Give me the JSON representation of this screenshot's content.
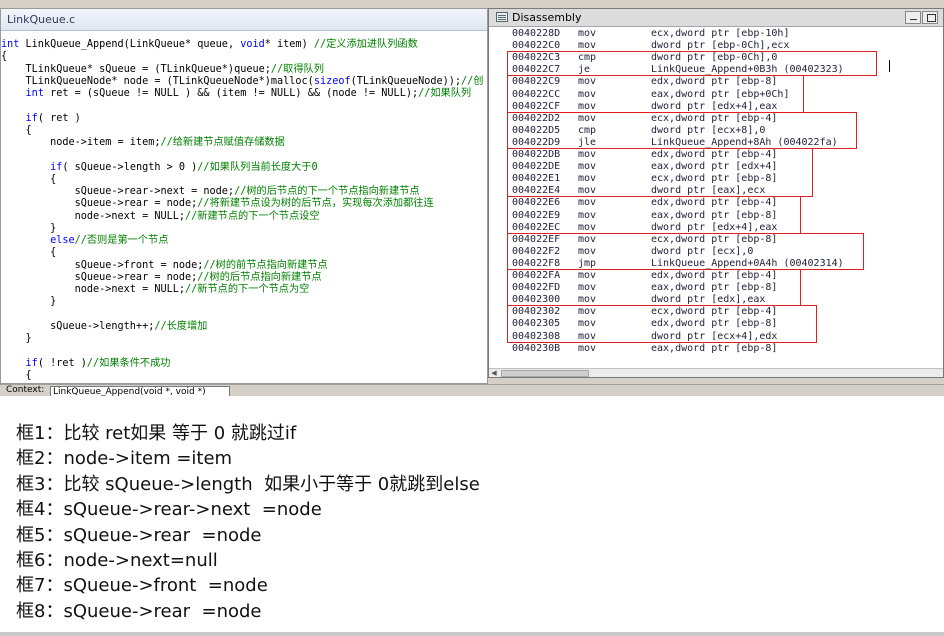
{
  "source_window": {
    "tab_title": "LinkQueue.c",
    "code_lines": [
      [
        {
          "t": "int",
          "c": "kw"
        },
        {
          "t": " LinkQueue_Append(LinkQueue* queue, "
        },
        {
          "t": "void",
          "c": "kw"
        },
        {
          "t": "* item) "
        },
        {
          "t": "//定义添加进队列函数",
          "c": "cm"
        }
      ],
      [
        {
          "t": "{"
        }
      ],
      [
        {
          "t": "    TLinkQueue* sQueue = (TLinkQueue*)queue;"
        },
        {
          "t": "//取得队列",
          "c": "cm"
        }
      ],
      [
        {
          "t": "    TLinkQueueNode* node = (TLinkQueueNode*)malloc("
        },
        {
          "t": "sizeof",
          "c": "kw"
        },
        {
          "t": "(TLinkQueueNode));"
        },
        {
          "t": "//创",
          "c": "cm"
        }
      ],
      [
        {
          "t": "    "
        },
        {
          "t": "int",
          "c": "kw"
        },
        {
          "t": " ret = (sQueue != NULL ) && (item != NULL) && (node != NULL);"
        },
        {
          "t": "//如果队列",
          "c": "cm"
        }
      ],
      [
        {
          "t": ""
        }
      ],
      [
        {
          "t": "    "
        },
        {
          "t": "if",
          "c": "kw"
        },
        {
          "t": "( ret )"
        }
      ],
      [
        {
          "t": "    {"
        }
      ],
      [
        {
          "t": "        node->item = item;"
        },
        {
          "t": "//给新建节点赋值存储数据",
          "c": "cm"
        }
      ],
      [
        {
          "t": ""
        }
      ],
      [
        {
          "t": "        "
        },
        {
          "t": "if",
          "c": "kw"
        },
        {
          "t": "( sQueue->length > 0 )"
        },
        {
          "t": "//如果队列当前长度大于0",
          "c": "cm"
        }
      ],
      [
        {
          "t": "        {"
        }
      ],
      [
        {
          "t": "            sQueue->rear->next = node;"
        },
        {
          "t": "//树的后节点的下一个节点指向新建节点",
          "c": "cm"
        }
      ],
      [
        {
          "t": "            sQueue->rear = node;"
        },
        {
          "t": "//将新建节点设为树的后节点，实现每次添加都往连",
          "c": "cm"
        }
      ],
      [
        {
          "t": "            node->next = NULL;"
        },
        {
          "t": "//新建节点的下一个节点设空",
          "c": "cm"
        }
      ],
      [
        {
          "t": "        }"
        }
      ],
      [
        {
          "t": "        "
        },
        {
          "t": "else",
          "c": "kw"
        },
        {
          "t": "//否则是第一个节点",
          "c": "cm"
        }
      ],
      [
        {
          "t": "        {"
        }
      ],
      [
        {
          "t": "            sQueue->front = node;"
        },
        {
          "t": "//树的前节点指向新建节点",
          "c": "cm"
        }
      ],
      [
        {
          "t": "            sQueue->rear = node;"
        },
        {
          "t": "//树的后节点指向新建节点",
          "c": "cm"
        }
      ],
      [
        {
          "t": "            node->next = NULL;"
        },
        {
          "t": "//新节点的下一个节点为空",
          "c": "cm"
        }
      ],
      [
        {
          "t": "        }"
        }
      ],
      [
        {
          "t": ""
        }
      ],
      [
        {
          "t": "        sQueue->length++;"
        },
        {
          "t": "//长度增加",
          "c": "cm"
        }
      ],
      [
        {
          "t": "    }"
        }
      ],
      [
        {
          "t": ""
        }
      ],
      [
        {
          "t": "    "
        },
        {
          "t": "if",
          "c": "kw"
        },
        {
          "t": "( !ret )"
        },
        {
          "t": "//如果条件不成功",
          "c": "cm"
        }
      ],
      [
        {
          "t": "    {"
        }
      ]
    ]
  },
  "disassembly": {
    "title": "Disassembly",
    "rows": [
      {
        "addr": "0040228D",
        "op": "mov",
        "arg": "ecx,dword ptr [ebp-10h]"
      },
      {
        "addr": "004022C0",
        "op": "mov",
        "arg": "dword ptr [ebp-0Ch],ecx"
      },
      {
        "addr": "004022C3",
        "op": "cmp",
        "arg": "dword ptr [ebp-0Ch],0"
      },
      {
        "addr": "004022C7",
        "op": "je",
        "arg": "LinkQueue_Append+0B3h (00402323)"
      },
      {
        "addr": "004022C9",
        "op": "mov",
        "arg": "edx,dword ptr [ebp-8]"
      },
      {
        "addr": "004022CC",
        "op": "mov",
        "arg": "eax,dword ptr [ebp+0Ch]"
      },
      {
        "addr": "004022CF",
        "op": "mov",
        "arg": "dword ptr [edx+4],eax"
      },
      {
        "addr": "004022D2",
        "op": "mov",
        "arg": "ecx,dword ptr [ebp-4]"
      },
      {
        "addr": "004022D5",
        "op": "cmp",
        "arg": "dword ptr [ecx+8],0"
      },
      {
        "addr": "004022D9",
        "op": "jle",
        "arg": "LinkQueue_Append+8Ah (004022fa)"
      },
      {
        "addr": "004022DB",
        "op": "mov",
        "arg": "edx,dword ptr [ebp-4]"
      },
      {
        "addr": "004022DE",
        "op": "mov",
        "arg": "eax,dword ptr [edx+4]"
      },
      {
        "addr": "004022E1",
        "op": "mov",
        "arg": "ecx,dword ptr [ebp-8]"
      },
      {
        "addr": "004022E4",
        "op": "mov",
        "arg": "dword ptr [eax],ecx"
      },
      {
        "addr": "004022E6",
        "op": "mov",
        "arg": "edx,dword ptr [ebp-4]"
      },
      {
        "addr": "004022E9",
        "op": "mov",
        "arg": "eax,dword ptr [ebp-8]"
      },
      {
        "addr": "004022EC",
        "op": "mov",
        "arg": "dword ptr [edx+4],eax"
      },
      {
        "addr": "004022EF",
        "op": "mov",
        "arg": "ecx,dword ptr [ebp-8]"
      },
      {
        "addr": "004022F2",
        "op": "mov",
        "arg": "dword ptr [ecx],0"
      },
      {
        "addr": "004022F8",
        "op": "jmp",
        "arg": "LinkQueue_Append+0A4h (00402314)"
      },
      {
        "addr": "004022FA",
        "op": "mov",
        "arg": "edx,dword ptr [ebp-4]"
      },
      {
        "addr": "004022FD",
        "op": "mov",
        "arg": "eax,dword ptr [ebp-8]"
      },
      {
        "addr": "00402300",
        "op": "mov",
        "arg": "dword ptr [edx],eax"
      },
      {
        "addr": "00402302",
        "op": "mov",
        "arg": "ecx,dword ptr [ebp-4]"
      },
      {
        "addr": "00402305",
        "op": "mov",
        "arg": "edx,dword ptr [ebp-8]"
      },
      {
        "addr": "00402308",
        "op": "mov",
        "arg": "dword ptr [ecx+4],edx"
      },
      {
        "addr": "0040230B",
        "op": "mov",
        "arg": "eax,dword ptr [ebp-8]"
      }
    ],
    "highlight_groups": [
      {
        "start": 2,
        "end": 3
      },
      {
        "start": 4,
        "end": 6
      },
      {
        "start": 7,
        "end": 9
      },
      {
        "start": 10,
        "end": 13
      },
      {
        "start": 14,
        "end": 16
      },
      {
        "start": 17,
        "end": 19
      },
      {
        "start": 20,
        "end": 22
      },
      {
        "start": 23,
        "end": 25
      }
    ],
    "highlight_color": "#e02020"
  },
  "context_bar": {
    "label": "Context:",
    "value": "LinkQueue_Append(void *, void *)"
  },
  "notes": [
    "框1：比较 ret如果 等于 0 就跳过if",
    "框2：node->item =item",
    "框3：比较 sQueue->length  如果小于等于 0就跳到else",
    "框4：sQueue->rear->next  =node",
    "框5：sQueue->rear  =node",
    "框6：node->next=null",
    "框7：sQueue->front  =node",
    "框8：sQueue->rear  =node"
  ]
}
